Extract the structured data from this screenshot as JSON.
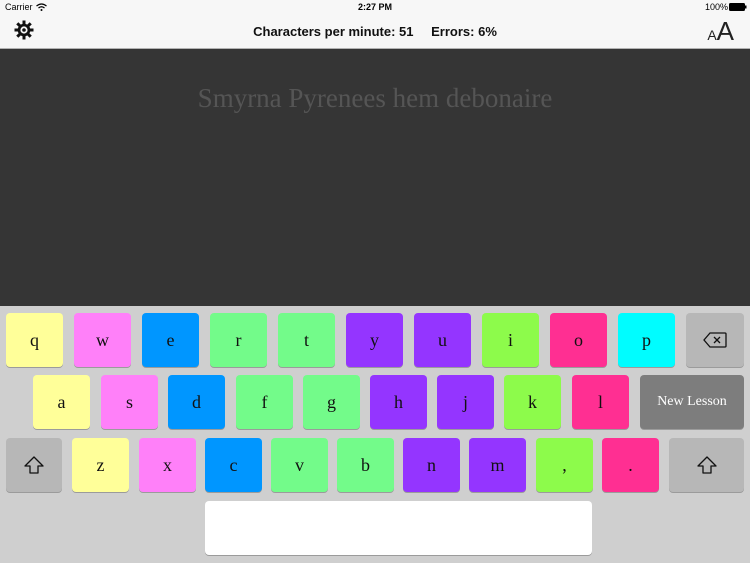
{
  "status_bar": {
    "carrier": "Carrier",
    "time": "2:27 PM",
    "battery": "100%"
  },
  "header": {
    "cpm": "Characters per minute: 51",
    "errors": "Errors: 6%",
    "font_small": "A",
    "font_large": "A"
  },
  "lesson": {
    "text": "Smyrna Pyrenees hem debonaire"
  },
  "keyboard": {
    "row1": [
      "q",
      "w",
      "e",
      "r",
      "t",
      "y",
      "u",
      "i",
      "o",
      "p"
    ],
    "row2": [
      "a",
      "s",
      "d",
      "f",
      "g",
      "h",
      "j",
      "k",
      "l"
    ],
    "row3": [
      "z",
      "x",
      "c",
      "v",
      "b",
      "n",
      "m",
      ",",
      "."
    ],
    "new_lesson": "New Lesson"
  },
  "colors": {
    "yellow": "#ffff99",
    "pink": "#ff80f9",
    "blue": "#0096ff",
    "green": "#73fb8a",
    "purple": "#9435ff",
    "lime": "#8dfb4b",
    "magenta": "#ff2f92",
    "cyan": "#00fdff",
    "lesson_bg": "#353535"
  }
}
